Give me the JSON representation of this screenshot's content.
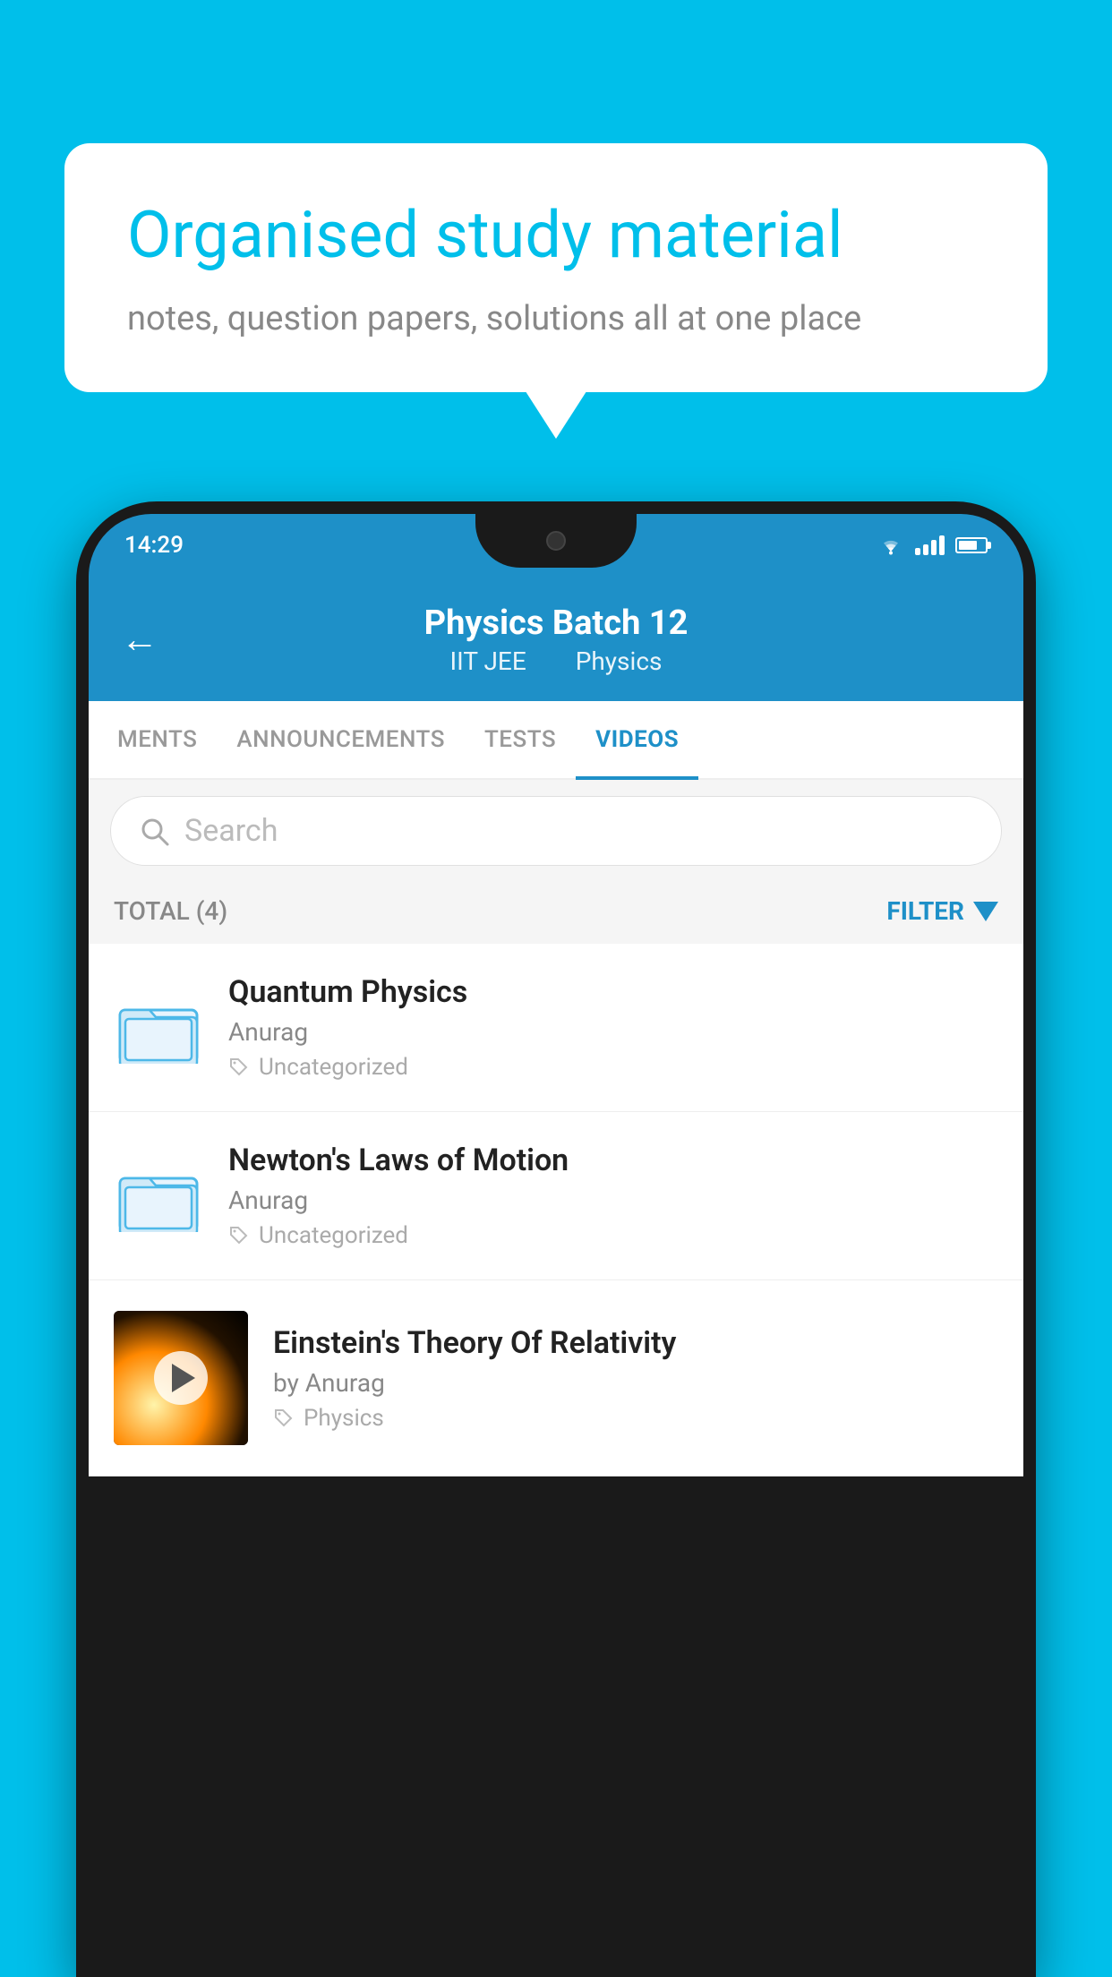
{
  "background": {
    "color": "#00BFEA"
  },
  "speech_bubble": {
    "title": "Organised study material",
    "subtitle": "notes, question papers, solutions all at one place"
  },
  "phone": {
    "status_bar": {
      "time": "14:29"
    },
    "header": {
      "title": "Physics Batch 12",
      "subtitle_left": "IIT JEE",
      "subtitle_right": "Physics",
      "back_label": "←"
    },
    "tabs": [
      {
        "label": "MENTS",
        "active": false
      },
      {
        "label": "ANNOUNCEMENTS",
        "active": false
      },
      {
        "label": "TESTS",
        "active": false
      },
      {
        "label": "VIDEOS",
        "active": true
      }
    ],
    "search": {
      "placeholder": "Search"
    },
    "filter_row": {
      "total_label": "TOTAL (4)",
      "filter_label": "FILTER"
    },
    "videos": [
      {
        "id": 1,
        "title": "Quantum Physics",
        "author": "Anurag",
        "tag": "Uncategorized",
        "has_thumbnail": false
      },
      {
        "id": 2,
        "title": "Newton's Laws of Motion",
        "author": "Anurag",
        "tag": "Uncategorized",
        "has_thumbnail": false
      },
      {
        "id": 3,
        "title": "Einstein's Theory Of Relativity",
        "author": "by Anurag",
        "tag": "Physics",
        "has_thumbnail": true
      }
    ]
  }
}
